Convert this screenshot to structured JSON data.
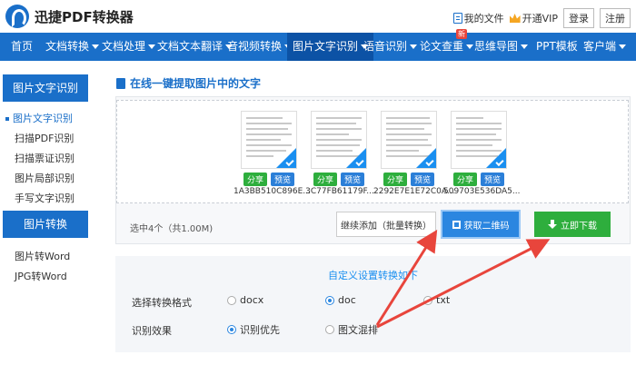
{
  "header": {
    "brand": "迅捷PDF转换器",
    "my_files": "我的文件",
    "vip": "开通VIP",
    "login": "登录",
    "register": "注册"
  },
  "nav": {
    "items": [
      {
        "label": "首页",
        "caret": false
      },
      {
        "label": "文档转换",
        "caret": true
      },
      {
        "label": "文档处理",
        "caret": true
      },
      {
        "label": "文档文本翻译",
        "caret": true
      },
      {
        "label": "音视频转换",
        "caret": true
      },
      {
        "label": "图片文字识别",
        "caret": true,
        "active": true
      },
      {
        "label": "语音识别",
        "caret": true
      },
      {
        "label": "论文查重",
        "caret": true
      },
      {
        "label": "思维导图",
        "caret": true
      },
      {
        "label": "PPT模板",
        "caret": false
      },
      {
        "label": "客户端",
        "caret": true
      }
    ],
    "new_badge": "新"
  },
  "sidebar": {
    "section1_title": "图片文字识别",
    "section1_items": [
      "图片文字识别",
      "扫描PDF识别",
      "扫描票证识别",
      "图片局部识别",
      "手写文字识别"
    ],
    "section2_title": "图片转换",
    "section2_items": [
      "图片转Word",
      "JPG转Word"
    ]
  },
  "main": {
    "title": "在线一键提取图片中的文字",
    "files": [
      {
        "name": "1A3BB510C896E...",
        "share": "分享",
        "preview": "预览"
      },
      {
        "name": "3C77FB61179F...",
        "share": "分享",
        "preview": "预览"
      },
      {
        "name": "2292E7E1E72C0A...",
        "share": "分享",
        "preview": "预览"
      },
      {
        "name": "509703E536DA5...",
        "share": "分享",
        "preview": "预览"
      }
    ],
    "selected_count": "选中4个（共1.00M)",
    "continue_add": "继续添加（批量转换）",
    "get_qr": "获取二维码",
    "download": "立即下载"
  },
  "settings": {
    "title": "自定义设置转换如下",
    "format_label": "选择转换格式",
    "format_options": [
      {
        "label": "docx",
        "selected": false
      },
      {
        "label": "doc",
        "selected": true
      },
      {
        "label": "txt",
        "selected": false
      }
    ],
    "effect_label": "识别效果",
    "effect_options": [
      {
        "label": "识别优先",
        "selected": true
      },
      {
        "label": "图文混排",
        "selected": false
      }
    ]
  },
  "colors": {
    "primary": "#1a6fc9",
    "nav_active": "#0c52a5",
    "download_green": "#2eae3d",
    "arrow_red": "#e8453c"
  }
}
